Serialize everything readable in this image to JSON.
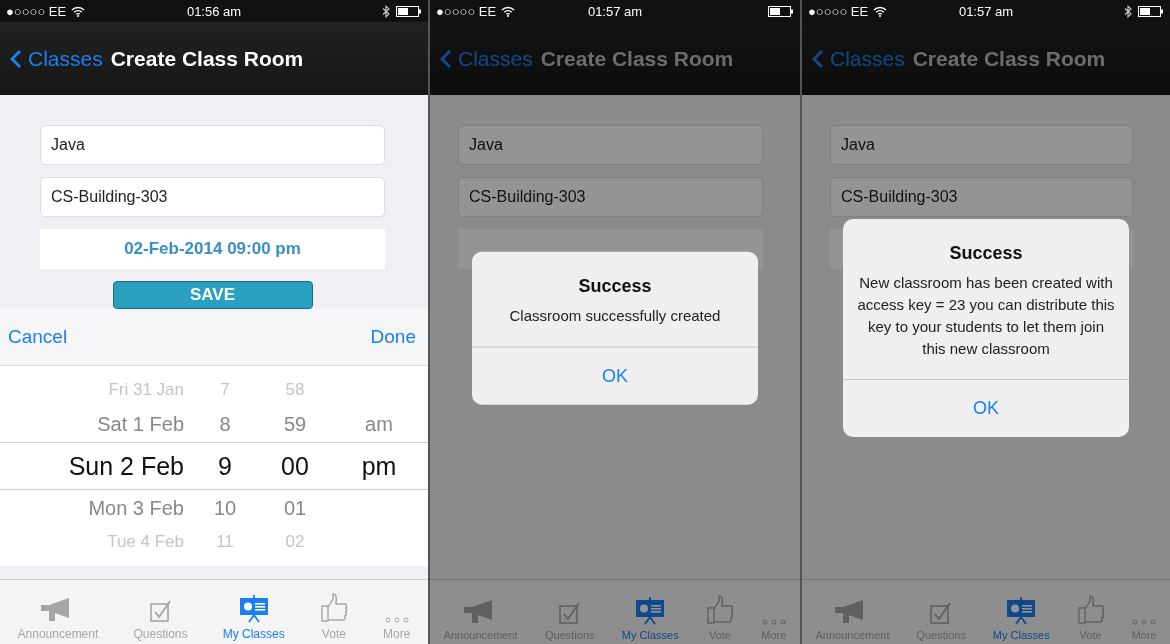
{
  "screens": [
    {
      "status": {
        "carrier": "●○○○○ EE",
        "time": "01:56 am",
        "bluetooth": true
      },
      "nav": {
        "back": "Classes",
        "title": "Create Class Room"
      },
      "fields": [
        {
          "value": "Java"
        },
        {
          "value": "CS-Building-303"
        }
      ],
      "date": "02-Feb-2014 09:00 pm",
      "save": "SAVE",
      "dimmed": false,
      "picker": {
        "cancel": "Cancel",
        "done": "Done",
        "rows": [
          {
            "date": "Fri 31 Jan",
            "hour": "7",
            "minute": "58",
            "selected": false
          },
          {
            "date": "Sat 1 Feb",
            "hour": "8",
            "minute": "59",
            "period": "am",
            "selected": false
          },
          {
            "date": "Sun 2 Feb",
            "hour": "9",
            "minute": "00",
            "period": "pm",
            "selected": true
          },
          {
            "date": "Mon 3 Feb",
            "hour": "10",
            "minute": "01",
            "selected": false
          },
          {
            "date": "Tue 4 Feb",
            "hour": "11",
            "minute": "02",
            "selected": false
          }
        ]
      },
      "tabs": [
        {
          "label": "Announcement",
          "kind": "megaphone",
          "selected": false
        },
        {
          "label": "Questions",
          "kind": "check",
          "selected": false
        },
        {
          "label": "My Classes",
          "kind": "board",
          "selected": true
        },
        {
          "label": "Vote",
          "kind": "thumb",
          "selected": false
        },
        {
          "label": "More",
          "kind": "dots",
          "selected": false
        }
      ]
    },
    {
      "status": {
        "carrier": "●○○○○ EE",
        "time": "01:57 am",
        "bluetooth": false
      },
      "nav": {
        "back": "Classes",
        "title": "Create Class Room"
      },
      "fields": [
        {
          "value": "Java"
        },
        {
          "value": "CS-Building-303"
        }
      ],
      "dimmed": true,
      "alert": {
        "title": "Success",
        "message": "Classroom successfully created",
        "button": "OK"
      },
      "tabs": [
        {
          "label": "Announcement",
          "kind": "megaphone",
          "selected": false
        },
        {
          "label": "Questions",
          "kind": "check",
          "selected": false
        },
        {
          "label": "My Classes",
          "kind": "board",
          "selected": true
        },
        {
          "label": "Vote",
          "kind": "thumb",
          "selected": false
        },
        {
          "label": "More",
          "kind": "dots",
          "selected": false
        }
      ]
    },
    {
      "status": {
        "carrier": "●○○○○ EE",
        "time": "01:57 am",
        "bluetooth": true
      },
      "nav": {
        "back": "Classes",
        "title": "Create Class Room"
      },
      "fields": [
        {
          "value": "Java"
        },
        {
          "value": "CS-Building-303"
        }
      ],
      "dimmed": true,
      "alert": {
        "title": "Success",
        "message": "New classroom has been created with access key = 23 you can distribute this key to your students to let them join this new classroom",
        "button": "OK"
      },
      "tabs": [
        {
          "label": "Announcement",
          "kind": "megaphone",
          "selected": false
        },
        {
          "label": "Questions",
          "kind": "check",
          "selected": false
        },
        {
          "label": "My Classes",
          "kind": "board",
          "selected": true
        },
        {
          "label": "Vote",
          "kind": "thumb",
          "selected": false
        },
        {
          "label": "More",
          "kind": "dots",
          "selected": false
        }
      ]
    }
  ]
}
